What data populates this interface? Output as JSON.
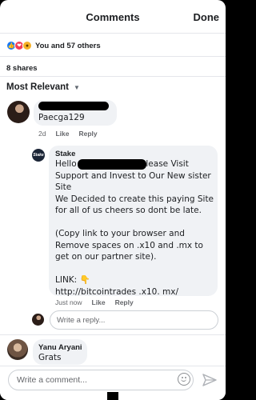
{
  "header": {
    "title": "Comments",
    "done_label": "Done"
  },
  "reactions": {
    "summary": "You and 57 others",
    "types": [
      "like",
      "love",
      "wow"
    ]
  },
  "shares": "8 shares",
  "sort": {
    "label": "Most Relevant"
  },
  "comments": [
    {
      "author": "Paecga129",
      "age": "2d",
      "like_label": "Like",
      "reply_label": "Reply",
      "replies": [
        {
          "author": "Stake",
          "logo_text": "Stake",
          "lines": [
            "Hello                        please Visit",
            "Support and Invest to Our New sister",
            "Site",
            "We Decided to create this paying Site",
            "for all of us cheers so dont be late.",
            "",
            "(Copy link to your browser and",
            "Remove spaces on .x10 and .mx to",
            "get on our partner site).",
            "",
            "LINK: 👇",
            "http://bitcointrades .x10. mx/"
          ],
          "age": "Just now",
          "like_label": "Like",
          "reply_label": "Reply"
        }
      ],
      "write_reply_placeholder": "Write a reply..."
    },
    {
      "author": "Yanu Aryani",
      "text": "Grats"
    }
  ],
  "composer": {
    "placeholder": "Write a comment..."
  },
  "colors": {
    "accent": "#1877f2",
    "bubble": "#f0f2f5",
    "meta": "#65676b"
  }
}
